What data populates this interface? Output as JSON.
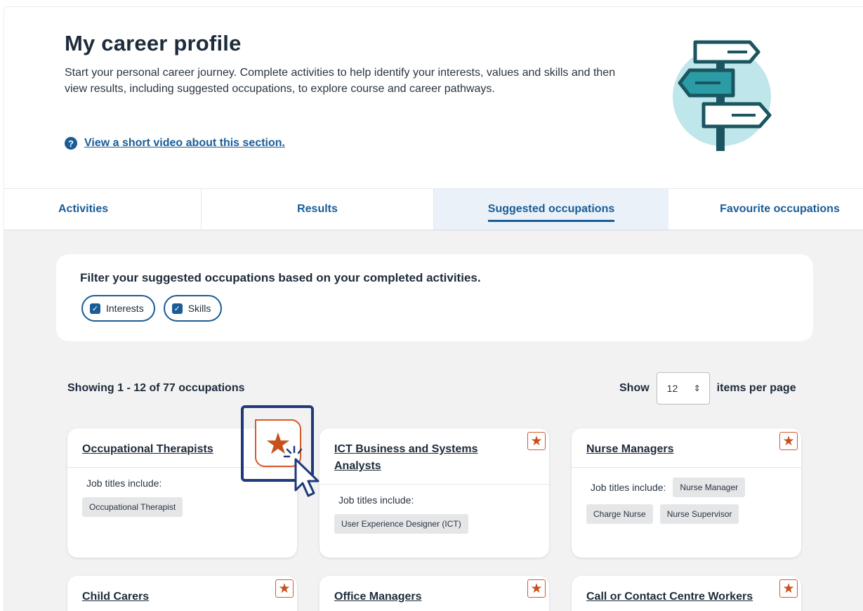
{
  "header": {
    "title": "My career profile",
    "intro": "Start your personal career journey. Complete activities to help identify your interests, values and skills and then view results, including suggested occupations, to explore course and career pathways.",
    "video_link": "View a short video about this section."
  },
  "tabs": [
    {
      "label": "Activities"
    },
    {
      "label": "Results"
    },
    {
      "label": "Suggested occupations",
      "active": true
    },
    {
      "label": "Favourite occupations"
    }
  ],
  "filter": {
    "title": "Filter your suggested occupations based on your completed activities.",
    "chips": [
      {
        "label": "Interests",
        "checked": true
      },
      {
        "label": "Skills",
        "checked": true
      }
    ]
  },
  "results": {
    "showing": "Showing 1 - 12 of 77 occupations",
    "show_label": "Show",
    "per_page_value": "12",
    "per_page_suffix": "items per page"
  },
  "cards": [
    {
      "title": "Occupational Therapists",
      "job_titles_label": "Job titles include:",
      "job_titles": [
        "Occupational Therapist"
      ]
    },
    {
      "title": "ICT Business and Systems Analysts",
      "job_titles_label": "Job titles include:",
      "job_titles": [
        "User Experience Designer (ICT)"
      ]
    },
    {
      "title": "Nurse Managers",
      "job_titles_label": "Job titles include:",
      "job_titles": [
        "Nurse Manager",
        "Charge Nurse",
        "Nurse Supervisor"
      ]
    },
    {
      "title": "Child Carers"
    },
    {
      "title": "Office Managers"
    },
    {
      "title": "Call or Contact Centre Workers"
    }
  ],
  "icons": {
    "help": "question-circle-icon",
    "favourite": "star-icon",
    "checkbox": "checkbox-checked-icon",
    "select_arrows": "sort-arrows-icon",
    "illustration": "signpost-illustration",
    "cursor": "pointer-cursor-icon"
  },
  "colors": {
    "brand_blue": "#1a5c96",
    "favourite_orange": "#c7501d",
    "active_tab_bg": "#eaf1f8",
    "callout_border": "#1f3a7a"
  },
  "glyphs": {
    "help": "?",
    "check": "✓",
    "star": "★",
    "select_arrows": "⇕"
  }
}
